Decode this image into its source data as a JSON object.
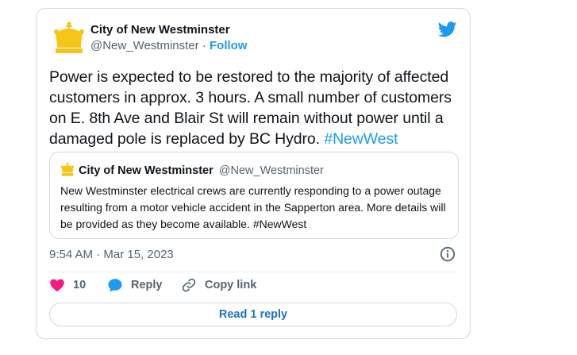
{
  "author": {
    "name": "City of New Westminster",
    "handle": "@New_Westminster",
    "separator": "·",
    "follow_label": "Follow"
  },
  "tweet": {
    "text": "Power is expected to be restored to the majority of affected customers in approx. 3 hours. A small number of customers on E. 8th Ave and Blair St will remain without power until a damaged pole is replaced by BC Hydro.",
    "hashtag": "#NewWest",
    "timestamp": "9:54 AM · Mar 15, 2023"
  },
  "quoted_tweet": {
    "name": "City of New Westminster",
    "handle": "@New_Westminster",
    "text": "New Westminster electrical crews are currently responding to a power outage resulting from a motor vehicle accident in the Sapperton area. More details will be provided as they become available. #NewWest"
  },
  "actions": {
    "like_count": "10",
    "reply_label": "Reply",
    "copy_link_label": "Copy link"
  },
  "read_replies_label": "Read 1 reply",
  "colors": {
    "accent": "#1d9bf0",
    "like": "#f91880",
    "crown_gold": "#f5c518",
    "muted": "#536471"
  },
  "icons": [
    "crown-icon",
    "twitter-bird-icon",
    "info-icon",
    "heart-icon",
    "reply-bubble-icon",
    "link-icon"
  ]
}
